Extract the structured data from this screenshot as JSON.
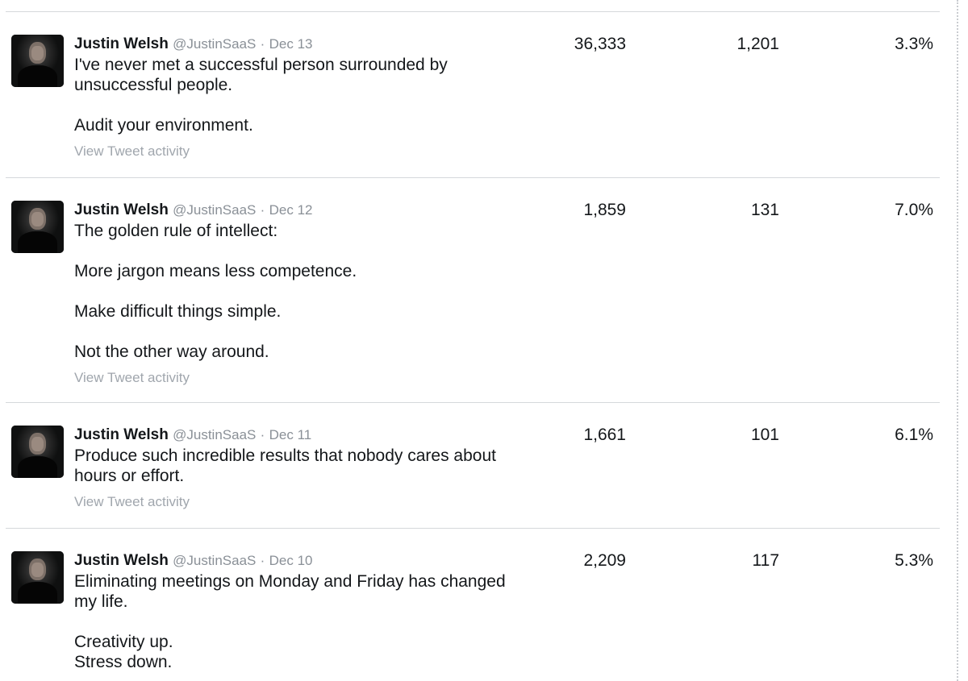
{
  "tweets": [
    {
      "name": "Justin Welsh",
      "handle": "@JustinSaaS",
      "date": "Dec 13",
      "text": "I've never met a successful person surrounded by\nunsuccessful people.\n\nAudit your environment.",
      "activity_link": "View Tweet activity",
      "impressions": "36,333",
      "engagements": "1,201",
      "engagement_rate": "3.3%"
    },
    {
      "name": "Justin Welsh",
      "handle": "@JustinSaaS",
      "date": "Dec 12",
      "text": "The golden rule of intellect:\n\nMore jargon means less competence.\n\nMake difficult things simple.\n\nNot the other way around.",
      "activity_link": "View Tweet activity",
      "impressions": "1,859",
      "engagements": "131",
      "engagement_rate": "7.0%"
    },
    {
      "name": "Justin Welsh",
      "handle": "@JustinSaaS",
      "date": "Dec 11",
      "text": "Produce such incredible results that nobody cares about\nhours or effort.",
      "activity_link": "View Tweet activity",
      "impressions": "1,661",
      "engagements": "101",
      "engagement_rate": "6.1%"
    },
    {
      "name": "Justin Welsh",
      "handle": "@JustinSaaS",
      "date": "Dec 10",
      "text": "Eliminating meetings on Monday and Friday has changed\nmy life.\n\nCreativity up.\nStress down.",
      "activity_link": "",
      "impressions": "2,209",
      "engagements": "117",
      "engagement_rate": "5.3%"
    }
  ],
  "separator": "·",
  "colors": {
    "text": "#14171a",
    "muted": "#8a9097",
    "link_muted": "#a0a6ad",
    "divider": "#d5d8db"
  }
}
